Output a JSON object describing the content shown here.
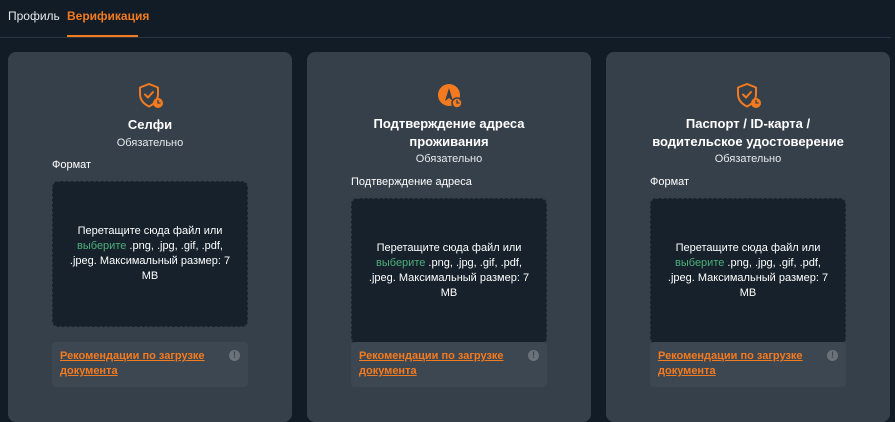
{
  "tabs": {
    "profile": "Профиль",
    "verification": "Верификация"
  },
  "cards": [
    {
      "title": "Селфи",
      "required": "Обязательно",
      "field_label": "Формат",
      "dropzone_prefix": "Перетащите сюда файл или",
      "dropzone_pick": "выберите",
      "dropzone_suffix": ".png, .jpg, .gif, .pdf, .jpeg. Максимальный размер: 7 MB",
      "reco_link": "Рекомендации по загрузке документа",
      "info": "!"
    },
    {
      "title": "Подтверждение адреса проживания",
      "required": "Обязательно",
      "field_label": "Подтверждение адреса",
      "dropzone_prefix": "Перетащите сюда файл или",
      "dropzone_pick": "выберите",
      "dropzone_suffix": ".png, .jpg, .gif, .pdf, .jpeg. Максимальный размер: 7 MB",
      "reco_link": "Рекомендации по загрузке документа",
      "info": "!"
    },
    {
      "title": "Паспорт / ID-карта / водительское удостоверение",
      "required": "Обязательно",
      "field_label": "Формат",
      "dropzone_prefix": "Перетащите сюда файл или",
      "dropzone_pick": "выберите",
      "dropzone_suffix": ".png, .jpg, .gif, .pdf, .jpeg. Максимальный размер: 7 MB",
      "reco_link": "Рекомендации по загрузке документа",
      "info": "!"
    }
  ],
  "colors": {
    "accent": "#f47a1f",
    "pick_link": "#4caf7a",
    "background": "#111c26",
    "card": "#36404a"
  },
  "icons": {
    "selfie": "shield-clock-icon",
    "address": "compass-clock-icon",
    "passport": "shield-clock-icon"
  }
}
